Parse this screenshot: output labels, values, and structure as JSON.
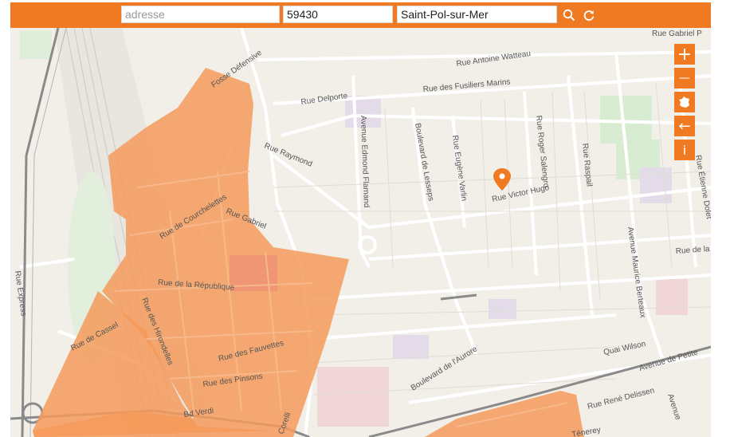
{
  "search": {
    "address_placeholder": "adresse",
    "postal_code": "59430",
    "city": "Saint-Pol-sur-Mer"
  },
  "icons": {
    "search": "search-icon",
    "refresh": "refresh-icon",
    "zoom_in": "plus-icon",
    "zoom_out": "minus-icon",
    "france": "france-map-icon",
    "back": "arrow-left-icon",
    "info": "info-icon"
  },
  "controls": {
    "zoom_in": "+",
    "zoom_out": "—",
    "back": "←",
    "info": "i"
  },
  "colors": {
    "accent": "#f07a22",
    "zone_fill": "#f59a5a",
    "marker": "#f07a22"
  },
  "streets": {
    "rue_gabriel_peri": "Rue Gabriel P",
    "rue_antoine_watteau": "Rue Antoine Watteau",
    "rue_fusiliers_marins": "Rue des Fusiliers Marins",
    "rue_delporte": "Rue Delporte",
    "fosse_defensive": "Fosse Défensive",
    "avenue_edmond_flamand": "Avenue Edmond Flamand",
    "boulevard_de_lesseps": "Boulevard de Lesseps",
    "rue_eugene_varlin": "Rue Eugène Varlin",
    "rue_roger_salengro": "Rue Roger Salengro",
    "rue_raspail": "Rue Raspail",
    "rue_etienne_dolet": "Rue Étienne Dolet",
    "rue_raymond": "Rue Raymond",
    "rue_victor_hugo": "Rue Victor Hugo",
    "rue_courchelettes": "Rue de Courchelettes",
    "rue_gabriel": "Rue Gabriel",
    "rue_republique": "Rue de la République",
    "avenue_maurice_berteaux": "Avenue Maurice Berteaux",
    "rue_de_la_r": "Rue de la R",
    "rue_express": "Rue Express",
    "rue_hirondelles": "Rue des Hirondelles",
    "rue_fauvettes": "Rue des Fauvettes",
    "rue_pinsons": "Rue des Pinsons",
    "rue_cassel": "Rue de Cassel",
    "bd_verdi": "Bd Verdi",
    "corelli": "Corelli",
    "boulevard_aurore": "Boulevard de l'Aurore",
    "quai_wilson": "Quai Wilson",
    "avenue_petite": "Avenue de Petite",
    "rue_rene_delissen": "Rue René Delissen",
    "avenue_e": "Avenue",
    "rue_tenerey": "Ténerey"
  }
}
